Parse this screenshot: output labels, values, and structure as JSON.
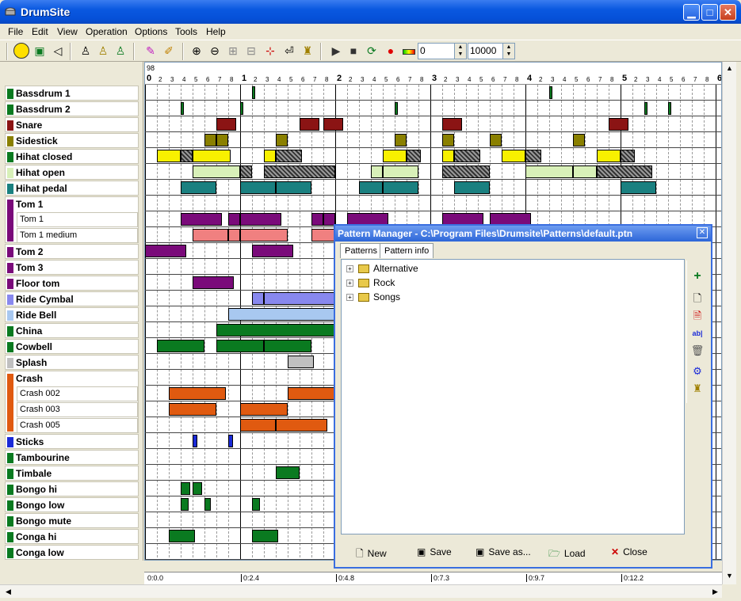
{
  "window": {
    "title": "DrumSite"
  },
  "menu": [
    "File",
    "Edit",
    "View",
    "Operation",
    "Options",
    "Tools",
    "Help"
  ],
  "toolbar": {
    "position_value": "0",
    "length_value": "10000"
  },
  "tracks": [
    {
      "name": "Bassdrum 1",
      "color": "#0a7a20"
    },
    {
      "name": "Bassdrum 2",
      "color": "#0a7a20"
    },
    {
      "name": "Snare",
      "color": "#8b1414"
    },
    {
      "name": "Sidestick",
      "color": "#8a8000"
    },
    {
      "name": "Hihat closed",
      "color": "#0a7a20"
    },
    {
      "name": "Hihat open",
      "color": "#d8f0b8"
    },
    {
      "name": "Hihat pedal",
      "color": "#1a8080"
    },
    {
      "name": "Tom 1",
      "color": "#7a0a7a",
      "subs": [
        "Tom 1",
        "Tom 1 medium"
      ]
    },
    {
      "name": "Tom 2",
      "color": "#7a0a7a"
    },
    {
      "name": "Tom 3",
      "color": "#7a0a7a"
    },
    {
      "name": "Floor tom",
      "color": "#7a0a7a"
    },
    {
      "name": "Ride Cymbal",
      "color": "#8888ee"
    },
    {
      "name": "Ride Bell",
      "color": "#a8c8f0"
    },
    {
      "name": "China",
      "color": "#0a7a20"
    },
    {
      "name": "Cowbell",
      "color": "#0a7a20"
    },
    {
      "name": "Splash",
      "color": "#c0c0c0"
    },
    {
      "name": "Crash",
      "color": "#e05a10",
      "subs": [
        "Crash 002",
        "Crash 003",
        "Crash 005"
      ]
    },
    {
      "name": "Sticks",
      "color": "#1a2ad8"
    },
    {
      "name": "Tambourine",
      "color": "#0a7a20"
    },
    {
      "name": "Timbale",
      "color": "#0a7a20"
    },
    {
      "name": "Bongo hi",
      "color": "#0a7a20"
    },
    {
      "name": "Bongo low",
      "color": "#0a7a20"
    },
    {
      "name": "Bongo mute",
      "color": "#0a7a20"
    },
    {
      "name": "Conga hi",
      "color": "#0a7a20"
    },
    {
      "name": "Conga low",
      "color": "#0a7a20"
    }
  ],
  "ruler": {
    "top_label": "98",
    "bars": [
      "0",
      "1",
      "2",
      "3",
      "4",
      "5",
      "6"
    ],
    "beats": [
      "2",
      "3",
      "4",
      "5",
      "6",
      "7",
      "8"
    ]
  },
  "timeline": [
    "0:0.0",
    "0:2.4",
    "0:4.8",
    "0:7.3",
    "0:9.7",
    "0:12.2"
  ],
  "pattern_manager": {
    "title": "Pattern Manager - C:\\Program Files\\Drumsite\\Patterns\\default.ptn",
    "tabs": [
      "Patterns",
      "Pattern info"
    ],
    "tree": [
      "Alternative",
      "Rock",
      "Songs"
    ],
    "buttons": {
      "new": "New",
      "save": "Save",
      "save_as": "Save as...",
      "load": "Load",
      "close": "Close"
    }
  },
  "colors": {
    "titlebar": "#0550d8",
    "hatch": "#333333"
  },
  "icons": [
    "smiley-icon",
    "loop-icon",
    "speaker-icon",
    "person-icon",
    "pencil-icon",
    "brush-icon",
    "zoom-in-icon",
    "zoom-out-icon",
    "crosshair-icon",
    "play-icon",
    "stop-icon",
    "repeat-icon",
    "record-icon",
    "level-meter-icon"
  ]
}
